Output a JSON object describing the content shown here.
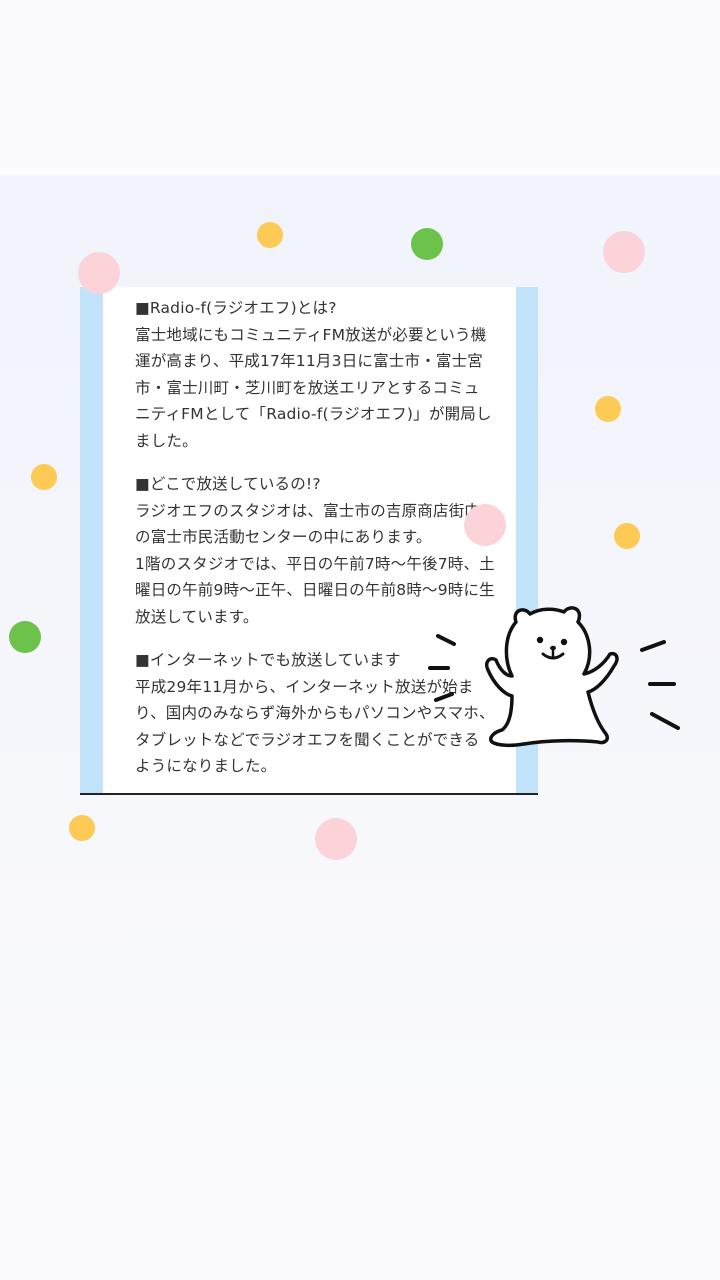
{
  "colors": {
    "stripe": "#c2e4fb",
    "dot_yellow": "#fcca55",
    "dot_green": "#6cc24a",
    "dot_pink": "#fcd3d8"
  },
  "article": {
    "sections": [
      {
        "heading": "■Radio-f(ラジオエフ)とは?",
        "body": "富士地域にもコミュニティFM放送が必要という機運が高まり、平成17年11月3日に富士市・富士宮市・富士川町・芝川町を放送エリアとするコミュニティFMとして「Radio-f(ラジオエフ)」が開局しました。"
      },
      {
        "heading": "■どこで放送しているの!?",
        "body": "ラジオエフのスタジオは、富士市の吉原商店街内の富士市民活動センターの中にあります。\n1階のスタジオでは、平日の午前7時〜午後7時、土曜日の午前9時〜正午、日曜日の午前8時〜9時に生放送しています。"
      },
      {
        "heading": "■インターネットでも放送しています",
        "body": "平成29年11月から、インターネット放送が始まり、国内のみならず海外からもパソコンやスマホ、タブレットなどでラジオエフを聞くことができるようになりました。"
      }
    ]
  },
  "decoration": {
    "character_icon": "waving-bear-icon",
    "confetti_icon": "confetti-dots"
  }
}
